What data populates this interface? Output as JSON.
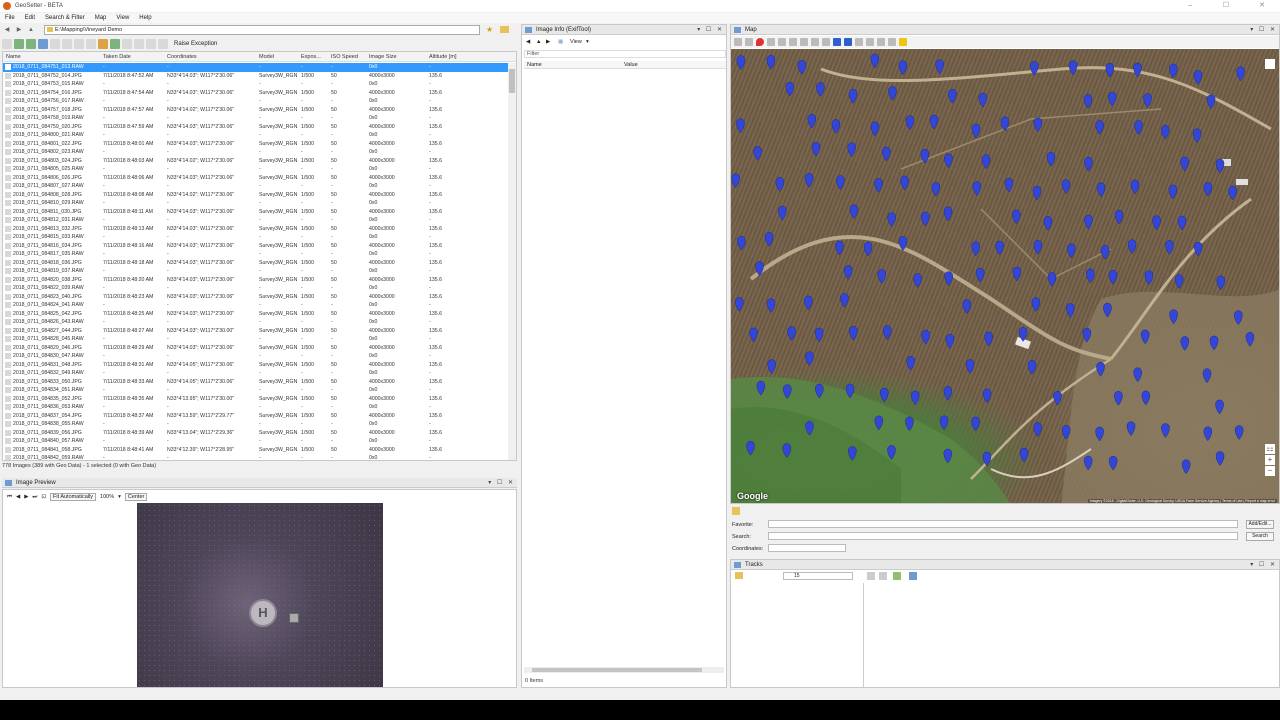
{
  "window": {
    "title": "GeoSetter - BETA"
  },
  "menu": [
    "File",
    "Edit",
    "Search & Filter",
    "Map",
    "View",
    "Help"
  ],
  "path": {
    "value": "E:\\Mapping\\Vineyard Demo"
  },
  "toolbar": {
    "raise_label": "Raise Exception"
  },
  "file_table": {
    "columns": [
      "Name",
      "Taken Date",
      "Coordinates",
      "Model",
      "Expos...",
      "ISO Speed",
      "Image Size",
      "Altitude [m]"
    ],
    "rows": [
      [
        "2018_0711_084751_013.RAW",
        "-",
        "-",
        "-",
        "-",
        "-",
        "0x0",
        "-"
      ],
      [
        "2018_0711_084752_014.JPG",
        "7/11/2018 8:47:52 AM",
        "N33°4'14.03\"; W117°2'30.06\"",
        "Survey3W_RGN",
        "1/500",
        "50",
        "4000x3000",
        "135.6"
      ],
      [
        "2018_0711_084753_015.RAW",
        "-",
        "-",
        "-",
        "-",
        "-",
        "0x0",
        "-"
      ],
      [
        "2018_0711_084754_016.JPG",
        "7/11/2018 8:47:54 AM",
        "N33°4'14.03\"; W117°2'30.06\"",
        "Survey3W_RGN",
        "1/500",
        "50",
        "4000x3000",
        "135.6"
      ],
      [
        "2018_0711_084756_017.RAW",
        "-",
        "-",
        "-",
        "-",
        "-",
        "0x0",
        "-"
      ],
      [
        "2018_0711_084757_018.JPG",
        "7/11/2018 8:47:57 AM",
        "N33°4'14.02\"; W117°2'30.06\"",
        "Survey3W_RGN",
        "1/500",
        "50",
        "4000x3000",
        "135.6"
      ],
      [
        "2018_0711_084758_019.RAW",
        "-",
        "-",
        "-",
        "-",
        "-",
        "0x0",
        "-"
      ],
      [
        "2018_0711_084759_020.JPG",
        "7/11/2018 8:47:59 AM",
        "N33°4'14.03\"; W117°2'30.06\"",
        "Survey3W_RGN",
        "1/500",
        "50",
        "4000x3000",
        "135.6"
      ],
      [
        "2018_0711_084800_021.RAW",
        "-",
        "-",
        "-",
        "-",
        "-",
        "0x0",
        "-"
      ],
      [
        "2018_0711_084801_022.JPG",
        "7/11/2018 8:48:01 AM",
        "N33°4'14.03\"; W117°2'30.06\"",
        "Survey3W_RGN",
        "1/500",
        "50",
        "4000x3000",
        "135.6"
      ],
      [
        "2018_0711_084802_023.RAW",
        "-",
        "-",
        "-",
        "-",
        "-",
        "0x0",
        "-"
      ],
      [
        "2018_0711_084803_024.JPG",
        "7/11/2018 8:48:03 AM",
        "N33°4'14.02\"; W117°2'30.06\"",
        "Survey3W_RGN",
        "1/500",
        "50",
        "4000x3000",
        "135.6"
      ],
      [
        "2018_0711_084805_025.RAW",
        "-",
        "-",
        "-",
        "-",
        "-",
        "0x0",
        "-"
      ],
      [
        "2018_0711_084806_026.JPG",
        "7/11/2018 8:48:06 AM",
        "N33°4'14.03\"; W117°2'30.06\"",
        "Survey3W_RGN",
        "1/500",
        "50",
        "4000x3000",
        "135.6"
      ],
      [
        "2018_0711_084807_027.RAW",
        "-",
        "-",
        "-",
        "-",
        "-",
        "0x0",
        "-"
      ],
      [
        "2018_0711_084808_028.JPG",
        "7/11/2018 8:48:08 AM",
        "N33°4'14.02\"; W117°2'30.06\"",
        "Survey3W_RGN",
        "1/500",
        "50",
        "4000x3000",
        "135.6"
      ],
      [
        "2018_0711_084810_029.RAW",
        "-",
        "-",
        "-",
        "-",
        "-",
        "0x0",
        "-"
      ],
      [
        "2018_0711_084811_030.JPG",
        "7/11/2018 8:48:11 AM",
        "N33°4'14.03\"; W117°2'30.06\"",
        "Survey3W_RGN",
        "1/500",
        "50",
        "4000x3000",
        "135.6"
      ],
      [
        "2018_0711_084812_031.RAW",
        "-",
        "-",
        "-",
        "-",
        "-",
        "0x0",
        "-"
      ],
      [
        "2018_0711_084813_032.JPG",
        "7/11/2018 8:48:13 AM",
        "N33°4'14.03\"; W117°2'30.06\"",
        "Survey3W_RGN",
        "1/500",
        "50",
        "4000x3000",
        "135.6"
      ],
      [
        "2018_0711_084815_033.RAW",
        "-",
        "-",
        "-",
        "-",
        "-",
        "0x0",
        "-"
      ],
      [
        "2018_0711_084816_034.JPG",
        "7/11/2018 8:48:16 AM",
        "N33°4'14.03\"; W117°2'30.06\"",
        "Survey3W_RGN",
        "1/500",
        "50",
        "4000x3000",
        "135.6"
      ],
      [
        "2018_0711_084817_035.RAW",
        "-",
        "-",
        "-",
        "-",
        "-",
        "0x0",
        "-"
      ],
      [
        "2018_0711_084818_036.JPG",
        "7/11/2018 8:48:18 AM",
        "N33°4'14.03\"; W117°2'30.06\"",
        "Survey3W_RGN",
        "1/500",
        "50",
        "4000x3000",
        "135.6"
      ],
      [
        "2018_0711_084819_037.RAW",
        "-",
        "-",
        "-",
        "-",
        "-",
        "0x0",
        "-"
      ],
      [
        "2018_0711_084820_038.JPG",
        "7/11/2018 8:48:20 AM",
        "N33°4'14.03\"; W117°2'30.06\"",
        "Survey3W_RGN",
        "1/500",
        "50",
        "4000x3000",
        "135.6"
      ],
      [
        "2018_0711_084822_039.RAW",
        "-",
        "-",
        "-",
        "-",
        "-",
        "0x0",
        "-"
      ],
      [
        "2018_0711_084823_040.JPG",
        "7/11/2018 8:48:23 AM",
        "N33°4'14.03\"; W117°2'30.06\"",
        "Survey3W_RGN",
        "1/500",
        "50",
        "4000x3000",
        "135.6"
      ],
      [
        "2018_0711_084824_041.RAW",
        "-",
        "-",
        "-",
        "-",
        "-",
        "0x0",
        "-"
      ],
      [
        "2018_0711_084825_042.JPG",
        "7/11/2018 8:48:25 AM",
        "N33°4'14.03\"; W117°2'30.00\"",
        "Survey3W_RGN",
        "1/500",
        "50",
        "4000x3000",
        "135.6"
      ],
      [
        "2018_0711_084826_043.RAW",
        "-",
        "-",
        "-",
        "-",
        "-",
        "0x0",
        "-"
      ],
      [
        "2018_0711_084827_044.JPG",
        "7/11/2018 8:48:27 AM",
        "N33°4'14.03\"; W117°2'30.00\"",
        "Survey3W_RGN",
        "1/500",
        "50",
        "4000x3000",
        "135.6"
      ],
      [
        "2018_0711_084828_045.RAW",
        "-",
        "-",
        "-",
        "-",
        "-",
        "0x0",
        "-"
      ],
      [
        "2018_0711_084829_046.JPG",
        "7/11/2018 8:48:29 AM",
        "N33°4'14.03\"; W117°2'30.06\"",
        "Survey3W_RGN",
        "1/500",
        "50",
        "4000x3000",
        "135.6"
      ],
      [
        "2018_0711_084830_047.RAW",
        "-",
        "-",
        "-",
        "-",
        "-",
        "0x0",
        "-"
      ],
      [
        "2018_0711_084831_048.JPG",
        "7/11/2018 8:48:31 AM",
        "N33°4'14.05\"; W117°2'30.06\"",
        "Survey3W_RGN",
        "1/500",
        "50",
        "4000x3000",
        "135.6"
      ],
      [
        "2018_0711_084832_049.RAW",
        "-",
        "-",
        "-",
        "-",
        "-",
        "0x0",
        "-"
      ],
      [
        "2018_0711_084833_050.JPG",
        "7/11/2018 8:48:33 AM",
        "N33°4'14.05\"; W117°2'30.06\"",
        "Survey3W_RGN",
        "1/500",
        "50",
        "4000x3000",
        "135.6"
      ],
      [
        "2018_0711_084834_051.RAW",
        "-",
        "-",
        "-",
        "-",
        "-",
        "0x0",
        "-"
      ],
      [
        "2018_0711_084835_052.JPG",
        "7/11/2018 8:48:35 AM",
        "N33°4'13.95\"; W117°2'30.00\"",
        "Survey3W_RGN",
        "1/500",
        "50",
        "4000x3000",
        "135.6"
      ],
      [
        "2018_0711_084836_053.RAW",
        "-",
        "-",
        "-",
        "-",
        "-",
        "0x0",
        "-"
      ],
      [
        "2018_0711_084837_054.JPG",
        "7/11/2018 8:48:37 AM",
        "N33°4'13.59\"; W117°2'29.77\"",
        "Survey3W_RGN",
        "1/500",
        "50",
        "4000x3000",
        "135.6"
      ],
      [
        "2018_0711_084838_055.RAW",
        "-",
        "-",
        "-",
        "-",
        "-",
        "0x0",
        "-"
      ],
      [
        "2018_0711_084839_056.JPG",
        "7/11/2018 8:48:39 AM",
        "N33°4'13.04\"; W117°2'29.36\"",
        "Survey3W_RGN",
        "1/500",
        "50",
        "4000x3000",
        "135.6"
      ],
      [
        "2018_0711_084840_057.RAW",
        "-",
        "-",
        "-",
        "-",
        "-",
        "0x0",
        "-"
      ],
      [
        "2018_0711_084841_058.JPG",
        "7/11/2018 8:48:41 AM",
        "N33°4'12.39\"; W117°2'28.95\"",
        "Survey3W_RGN",
        "1/500",
        "50",
        "4000x3000",
        "135.6"
      ],
      [
        "2018_0711_084842_059.RAW",
        "-",
        "-",
        "-",
        "-",
        "-",
        "0x0",
        "-"
      ]
    ]
  },
  "status": {
    "text": "778 Images (389 with Geo Data) - 1 selected (0 with Geo Data)"
  },
  "preview": {
    "title": "Image Preview",
    "fit_label": "Fit Automatically",
    "zoom_value": "100%",
    "center_label": "Center",
    "helipad_letter": "H"
  },
  "info": {
    "title": "Image Info (ExifTool)",
    "view_label": "View",
    "filter_label": "Filter",
    "col_name": "Name",
    "col_value": "Value",
    "count": "0 Items"
  },
  "map": {
    "title": "Map",
    "logo": "Google",
    "copyright": "Imagery ©2018 , DigitalGlobe, U.S. Geological Survey, USDA Farm Service Agency | Terms of Use | Report a map error",
    "marker_color": "#3346d6",
    "marker_count": 389
  },
  "search": {
    "favorite_label": "Favorite:",
    "search_label": "Search:",
    "coordinates_label": "Coordinates:",
    "addedit_label": "Add/Edit...",
    "search_button": "Search"
  },
  "tracks": {
    "title": "Tracks",
    "count_value": "15"
  },
  "colors": {
    "selection": "#3399ff",
    "accent": "#6f9bd3"
  }
}
